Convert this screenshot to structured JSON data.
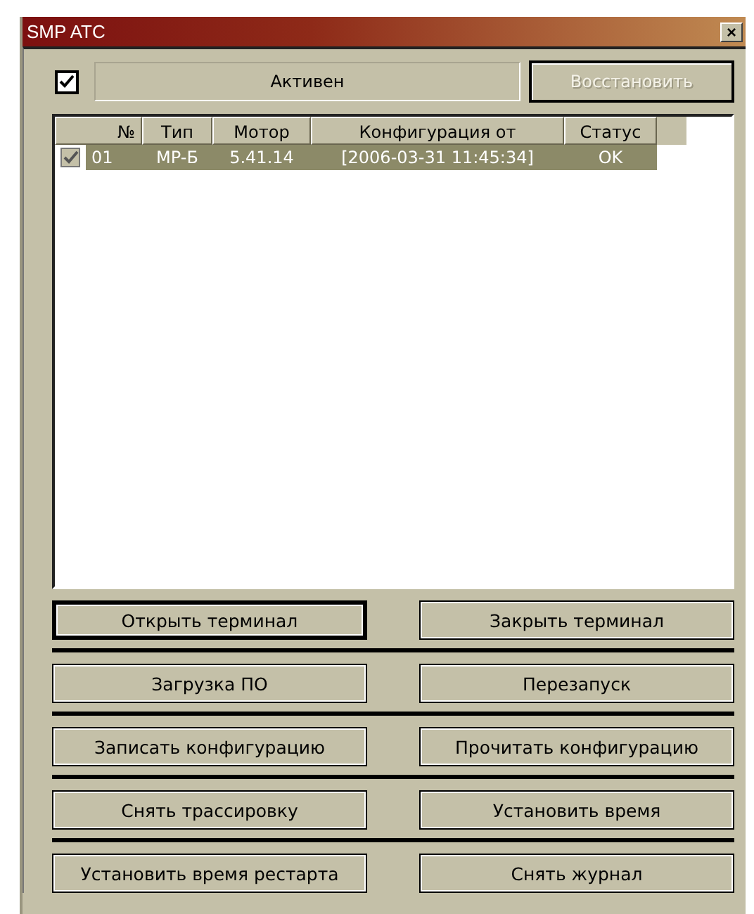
{
  "window": {
    "title": "SMP ATC",
    "close": "×"
  },
  "active": {
    "checked": true,
    "label": "Активен"
  },
  "restore_button": {
    "label": "Восстановить",
    "disabled": true
  },
  "table": {
    "columns": [
      "№",
      "Тип",
      "Мотор",
      "Конфигурация от",
      "Статус"
    ],
    "rows": [
      {
        "checked": true,
        "selected": true,
        "cells": [
          "01",
          "MP-Б",
          "5.41.14",
          "[2006-03-31 11:45:34]",
          "OK"
        ]
      }
    ]
  },
  "button_rows": [
    [
      {
        "label": "Открыть терминал",
        "default": true
      },
      {
        "label": "Закрыть терминал",
        "default": false
      }
    ],
    [
      {
        "label": "Загрузка ПО",
        "default": false
      },
      {
        "label": "Перезапуск",
        "default": false
      }
    ],
    [
      {
        "label": "Записать конфигурацию",
        "default": false
      },
      {
        "label": "Прочитать конфигурацию",
        "default": false
      }
    ],
    [
      {
        "label": "Снять трассировку",
        "default": false
      },
      {
        "label": "Установить время",
        "default": false
      }
    ],
    [
      {
        "label": "Установить время рестарта",
        "default": false
      },
      {
        "label": "Снять журнал",
        "default": false
      }
    ]
  ]
}
